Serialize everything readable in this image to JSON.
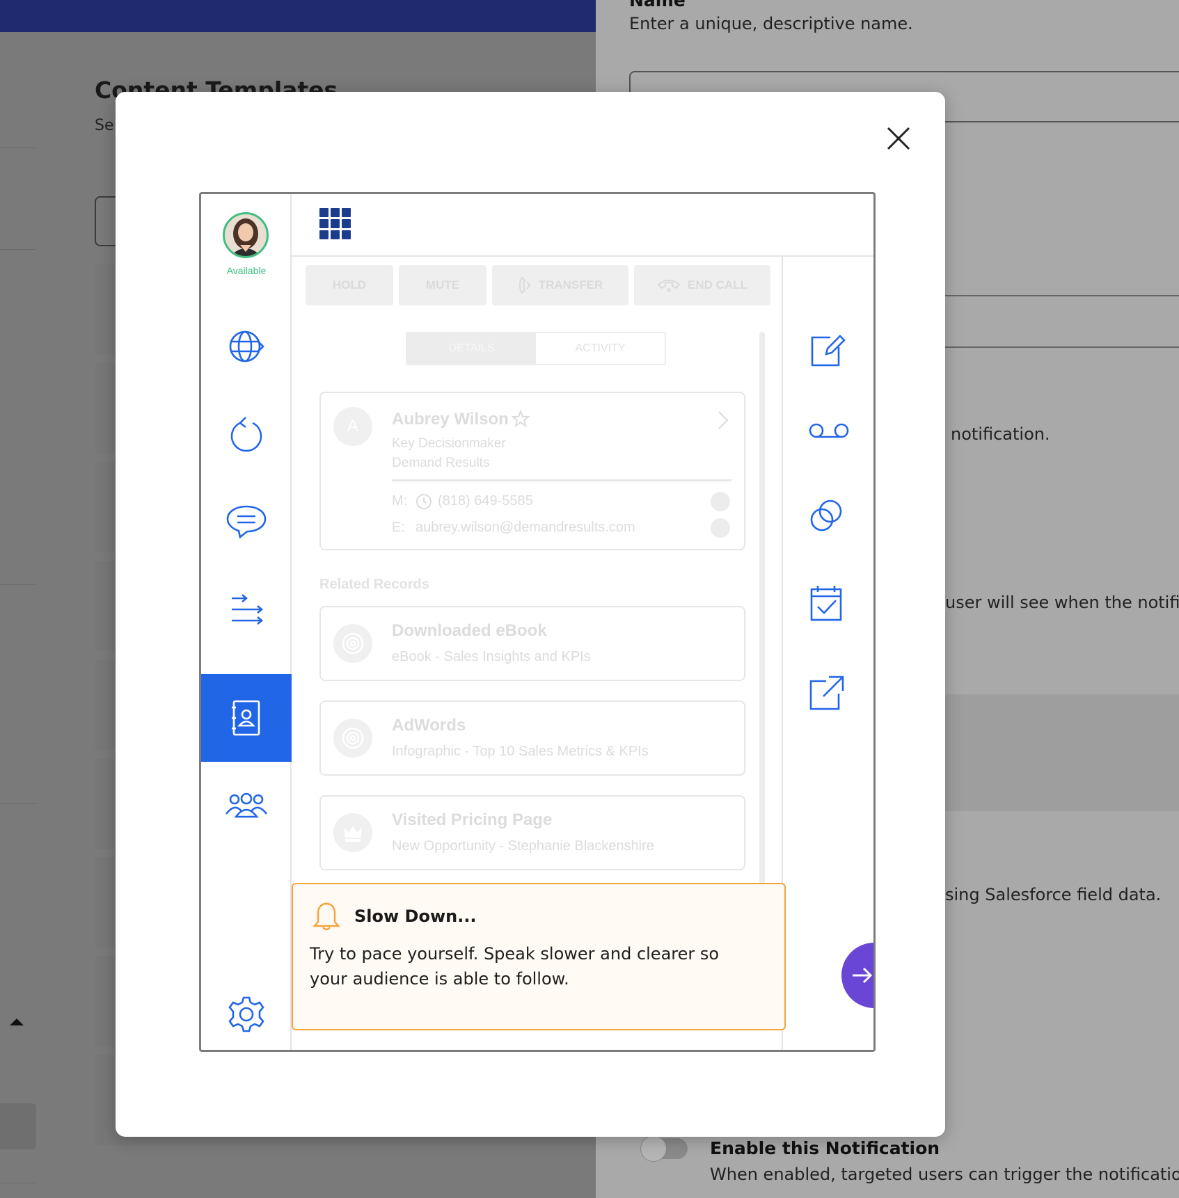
{
  "background": {
    "page_title": "Content Templates",
    "page_subtitle": "Se",
    "form": {
      "name_label": "Name",
      "name_help": "Enter a unique, descriptive name.",
      "notification_fragment": "notification.",
      "user_fragment": "user will see when the notifi",
      "salesforce_fragment": "sing Salesforce field data.",
      "enable_title": "Enable this Notification",
      "enable_description": "When enabled, targeted users can trigger the notification"
    }
  },
  "modal": {
    "illustration": {
      "agent_status": "Available",
      "call_controls": {
        "hold": "HOLD",
        "mute": "MUTE",
        "transfer": "TRANSFER",
        "end_call": "END CALL"
      },
      "tabs": {
        "details": "DETAILS",
        "activity": "ACTIVITY"
      },
      "contact": {
        "initial": "A",
        "name": "Aubrey Wilson",
        "role": "Key Decisionmaker",
        "company": "Demand Results",
        "mobile_label": "M:",
        "mobile": "(818) 649-5585",
        "email_label": "E:",
        "email": "aubrey.wilson@demandresults.com"
      },
      "related_records_label": "Related Records",
      "related_records": [
        {
          "title": "Downloaded eBook",
          "subtitle": "eBook - Sales Insights and KPIs"
        },
        {
          "title": "AdWords",
          "subtitle": "Infographic - Top 10 Sales Metrics & KPIs"
        },
        {
          "title": "Visited Pricing Page",
          "subtitle": "New Opportunity - Stephanie Blackenshire"
        }
      ],
      "alert": {
        "title": "Slow Down...",
        "body": "Try to pace yourself. Speak slower and clearer so your audience is able to follow."
      }
    },
    "icons": {
      "rail": [
        "globe-icon",
        "refresh-icon",
        "chat-icon",
        "transfer-arrows-icon",
        "contact-card-icon",
        "team-icon",
        "settings-icon"
      ],
      "tools": [
        "edit-note-icon",
        "voicemail-icon",
        "linked-circles-icon",
        "calendar-check-icon",
        "external-link-icon"
      ]
    },
    "colors": {
      "accent_blue": "#2266e8",
      "status_green": "#3fbf7f",
      "alert_orange": "#f5a33c",
      "fab_purple": "#6a46d6",
      "header_navy": "#1f2b6e"
    }
  }
}
